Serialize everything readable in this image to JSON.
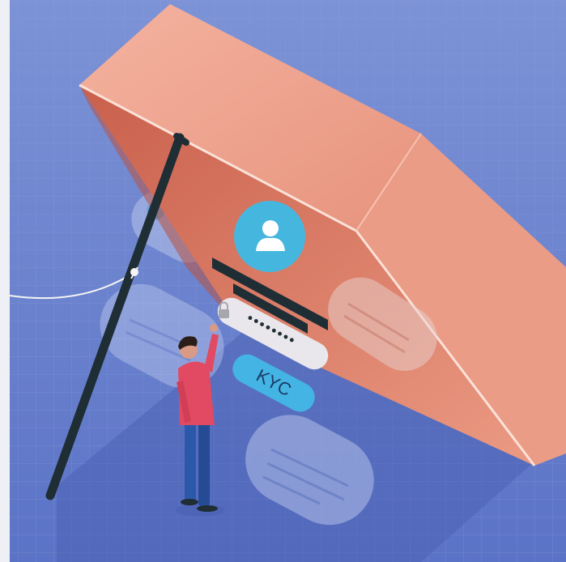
{
  "illustration": {
    "kyc_label": "KYC",
    "password_mask": "••••••••",
    "colors": {
      "background": "#6e86cf",
      "box_outer": "#f0a690",
      "box_inner": "#d9755f",
      "stick": "#1f2d35",
      "avatar": "#45b7de",
      "kyc_pill": "#43b4e3",
      "person_hoodie": "#e14a62",
      "person_jeans": "#2b58a8"
    },
    "icons": [
      "user-avatar-icon",
      "lock-icon"
    ]
  }
}
